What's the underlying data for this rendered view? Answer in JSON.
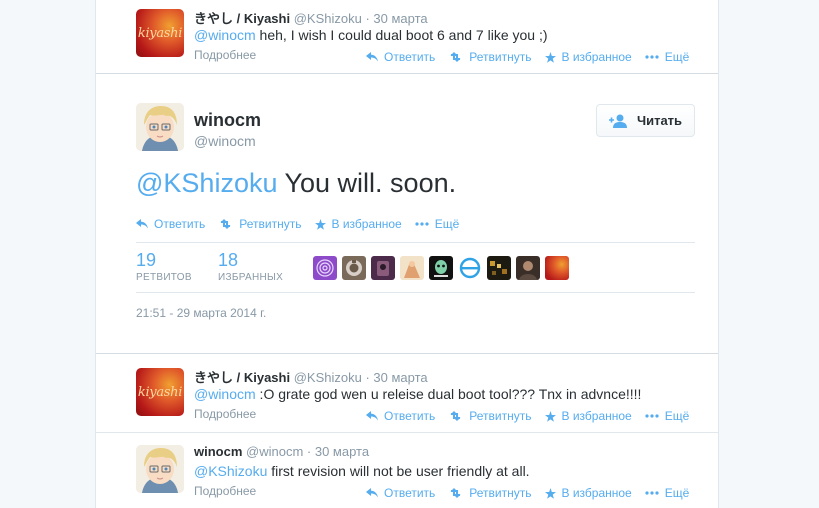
{
  "tweets_above": [
    {
      "name": "きやし / Kiyashi",
      "screen_name": "@KShizoku",
      "time": "· 30 марта",
      "avatar_text": "kiyashi",
      "mention": "@winocm",
      "text": " heh, I wish I could dual boot 6 and 7 like you ;)",
      "details": "Подробнее"
    }
  ],
  "actions": {
    "reply": "Ответить",
    "retweet": "Ретвитнуть",
    "favorite": "В избранное",
    "more": "Ещё"
  },
  "main_tweet": {
    "name": "winocm",
    "screen_name": "@winocm",
    "follow_label": "Читать",
    "mention": "@KShizoku",
    "text": " You will. soon.",
    "retweets_count": "19",
    "retweets_label": "РЕТВИТОВ",
    "favorites_count": "18",
    "favorites_label": "ИЗБРАННЫХ",
    "timestamp": "21:51 - 29 марта 2014 г."
  },
  "tweets_below": [
    {
      "name": "きやし / Kiyashi",
      "screen_name": "@KShizoku",
      "time": "· 30 марта",
      "avatar_text": "kiyashi",
      "mention": "@winocm",
      "text": " :O grate god wen u releise dual boot tool??? Tnx in advnce!!!!",
      "details": "Подробнее"
    },
    {
      "name": "winocm",
      "screen_name": "@winocm",
      "time": "· 30 марта",
      "mention": "@KShizoku",
      "text": " first revision will not be user friendly at all.",
      "details": "Подробнее"
    }
  ],
  "colors": {
    "accent": "#55acee",
    "text": "#292f33",
    "muted": "#8899a6",
    "border": "#e1e8ed",
    "background": "#f5f8fa"
  },
  "icons": [
    "reply-icon",
    "retweet-icon",
    "star-icon",
    "more-icon",
    "follow-person-icon"
  ]
}
